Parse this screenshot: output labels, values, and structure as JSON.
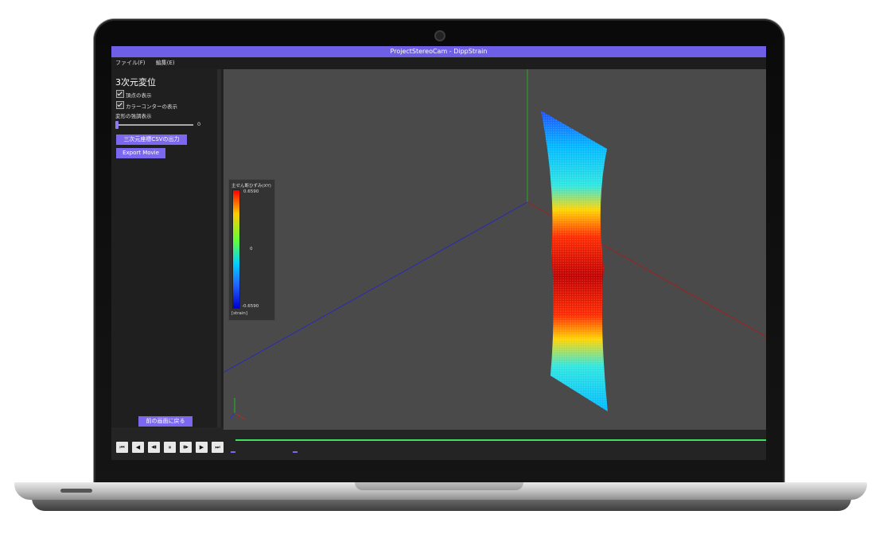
{
  "window": {
    "title": "ProjectStereoCam - DippStrain"
  },
  "menu": [
    {
      "label": "ファイル(F)"
    },
    {
      "label": "編集(E)"
    }
  ],
  "panel": {
    "title": "3次元変位",
    "show_vertices": {
      "label": "頂点の表示",
      "checked": true
    },
    "show_contour": {
      "label": "カラーコンターの表示",
      "checked": true
    },
    "deform_label": "変形の強調表示",
    "deform_value": "0",
    "csv_button": "三次元座標CSVの出力",
    "movie_button": "Export Movie",
    "back_button": "前の画面に戻る"
  },
  "legend": {
    "title": "主せん断ひずみ(XY)",
    "max": "0.6590",
    "mid": "0",
    "min": "-0.6590",
    "unit": "[strain]"
  },
  "playback": [
    {
      "name": "first",
      "symbol": "⏮"
    },
    {
      "name": "prev",
      "symbol": "◀"
    },
    {
      "name": "step-back",
      "symbol": "◀▮"
    },
    {
      "name": "pause",
      "symbol": "⏸"
    },
    {
      "name": "step-forward",
      "symbol": "▮▶"
    },
    {
      "name": "play",
      "symbol": "▶"
    },
    {
      "name": "last",
      "symbol": "⏭"
    }
  ],
  "colors": {
    "accent": "#7b68ee",
    "titlebar": "#6e5fe6",
    "viewport": "#4a4a4a",
    "timeline": "#3fe060"
  }
}
